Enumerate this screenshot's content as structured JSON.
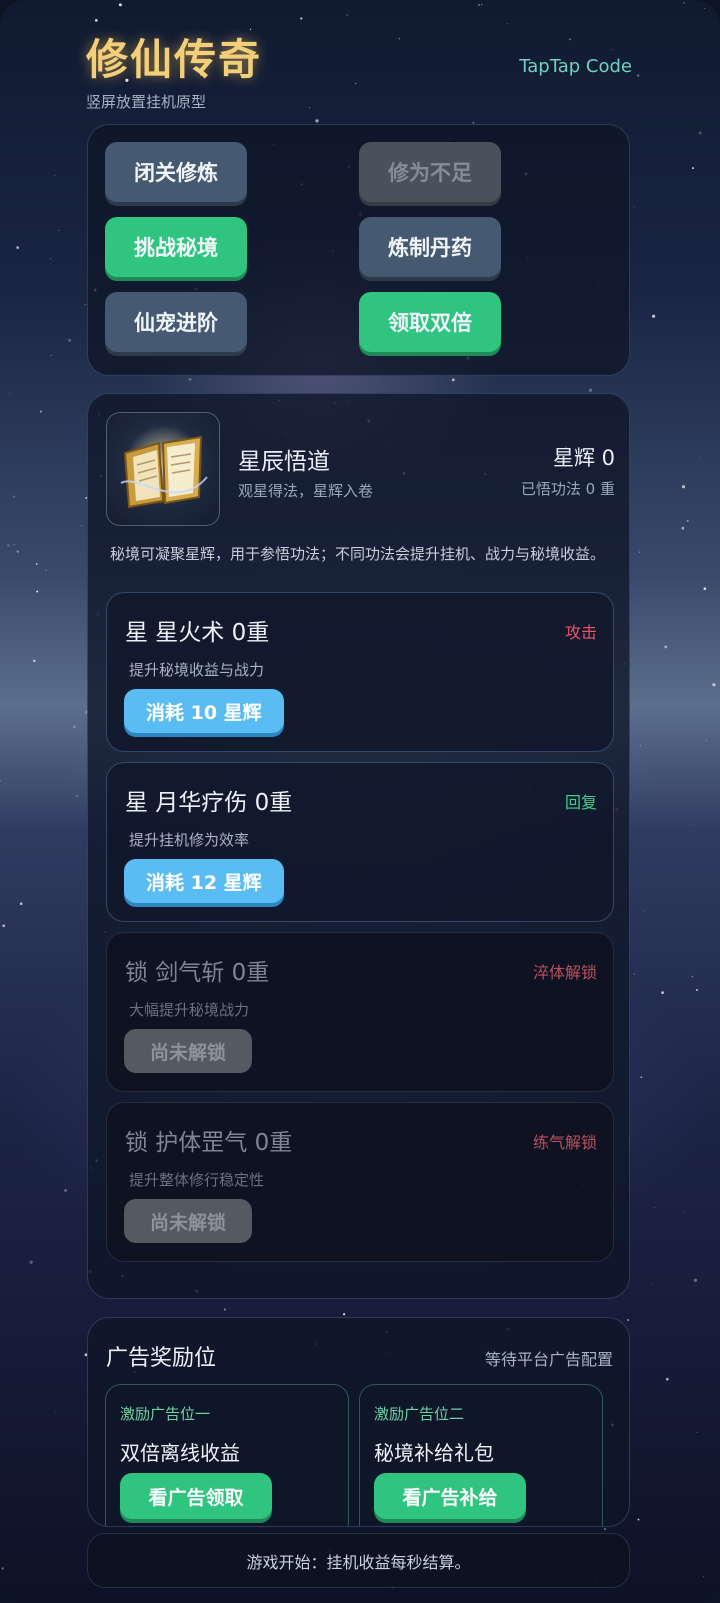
{
  "header": {
    "title": "修仙传奇",
    "subtitle": "竖屏放置挂机原型",
    "code_link": "TapTap Code"
  },
  "actions": [
    {
      "label": "闭关修炼",
      "style": "gray"
    },
    {
      "label": "修为不足",
      "style": "disabled"
    },
    {
      "label": "挑战秘境",
      "style": "green"
    },
    {
      "label": "炼制丹药",
      "style": "gray"
    },
    {
      "label": "仙宠进阶",
      "style": "gray"
    },
    {
      "label": "领取双倍",
      "style": "green"
    }
  ],
  "star_panel": {
    "icon": "magic-book-icon",
    "title": "星辰悟道",
    "subtitle": "观星得法，星辉入卷",
    "star_count": "星辉 0",
    "learned": "已悟功法 0 重",
    "description": "秘境可凝聚星辉，用于参悟功法；不同功法会提升挂机、战力与秘境收益。",
    "skills": [
      {
        "name": "星 星火术  0重",
        "tag": "攻击",
        "tag_color": "#e8536a",
        "desc": "提升秘境收益与战力",
        "button": "消耗 10 星辉",
        "locked": false
      },
      {
        "name": "星 月华疗伤  0重",
        "tag": "回复",
        "tag_color": "#3fcf8e",
        "desc": "提升挂机修为效率",
        "button": "消耗 12 星辉",
        "locked": false
      },
      {
        "name": "锁 剑气斩  0重",
        "tag": "淬体解锁",
        "tag_color": "#b9515f",
        "desc": "大幅提升秘境战力",
        "button": "尚未解锁",
        "locked": true
      },
      {
        "name": "锁 护体罡气  0重",
        "tag": "练气解锁",
        "tag_color": "#b9515f",
        "desc": "提升整体修行稳定性",
        "button": "尚未解锁",
        "locked": true
      }
    ]
  },
  "ads": {
    "title": "广告奖励位",
    "status": "等待平台广告配置",
    "slots": [
      {
        "slot": "激励广告位一",
        "name": "双倍离线收益",
        "button": "看广告领取"
      },
      {
        "slot": "激励广告位二",
        "name": "秘境补给礼包",
        "button": "看广告补给"
      }
    ]
  },
  "footer": {
    "message": "游戏开始：挂机收益每秒结算。"
  }
}
